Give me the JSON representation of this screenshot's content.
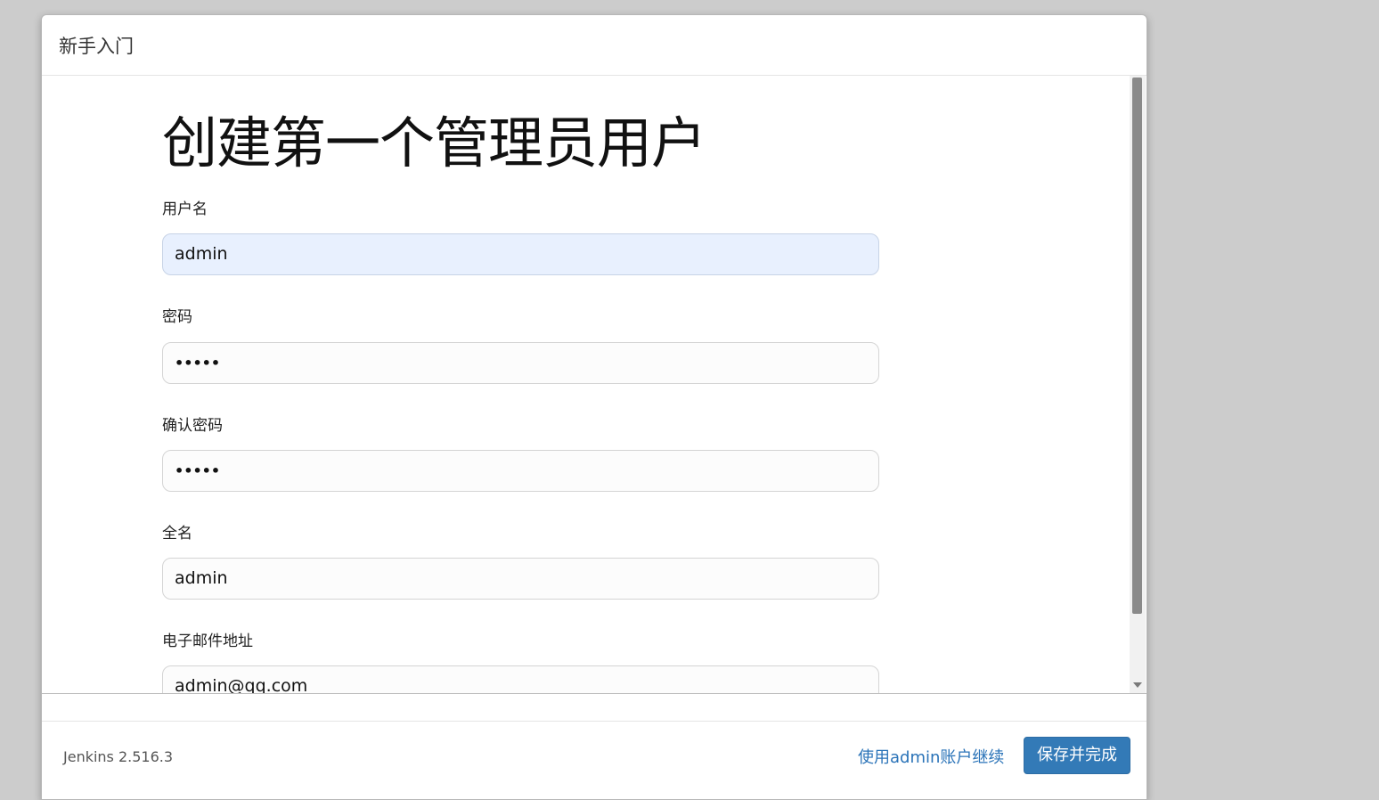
{
  "dialog": {
    "title": "新手入门"
  },
  "form": {
    "heading": "创建第一个管理员用户",
    "fields": [
      {
        "label": "用户名",
        "value": "admin",
        "type": "text",
        "autofilled": true
      },
      {
        "label": "密码",
        "value": "•••••",
        "type": "password"
      },
      {
        "label": "确认密码",
        "value": "•••••",
        "type": "password"
      },
      {
        "label": "全名",
        "value": "admin",
        "type": "text"
      },
      {
        "label": "电子邮件地址",
        "value": "admin@qq.com",
        "type": "text"
      }
    ]
  },
  "footer": {
    "version": "Jenkins 2.516.3",
    "skip_label": "使用admin账户继续",
    "save_label": "保存并完成"
  },
  "colors": {
    "primary_button": "#337ab7",
    "link": "#2a73b8",
    "autofill_bg": "#e8f0fe"
  }
}
